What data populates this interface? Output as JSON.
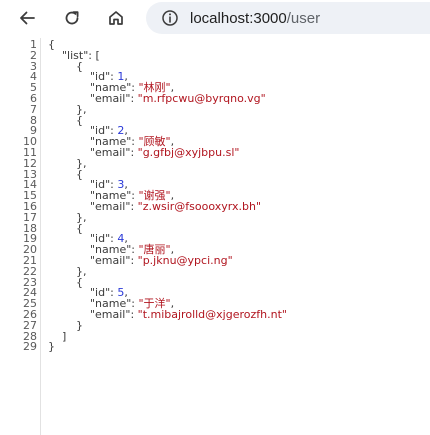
{
  "browser": {
    "url_host": "localhost:3000",
    "url_path": "/user"
  },
  "json_view": {
    "root_key": "list",
    "items": [
      {
        "id": 1,
        "name": "林刚",
        "email": "m.rfpcwu@byrqno.vg"
      },
      {
        "id": 2,
        "name": "顾敏",
        "email": "g.gfbj@xyjbpu.sl"
      },
      {
        "id": 3,
        "name": "谢强",
        "email": "z.wsir@fsoooxyrx.bh"
      },
      {
        "id": 4,
        "name": "唐丽",
        "email": "p.jknu@ypci.ng"
      },
      {
        "id": 5,
        "name": "于洋",
        "email": "t.mibajrolld@xjgerozfh.nt"
      }
    ]
  },
  "colors": {
    "key": "#3b3b3b",
    "string": "#b1151f",
    "number": "#2a39d8"
  },
  "icons": {
    "back": "arrow-left-icon",
    "reload": "reload-icon",
    "home": "home-icon",
    "info": "info-icon"
  }
}
